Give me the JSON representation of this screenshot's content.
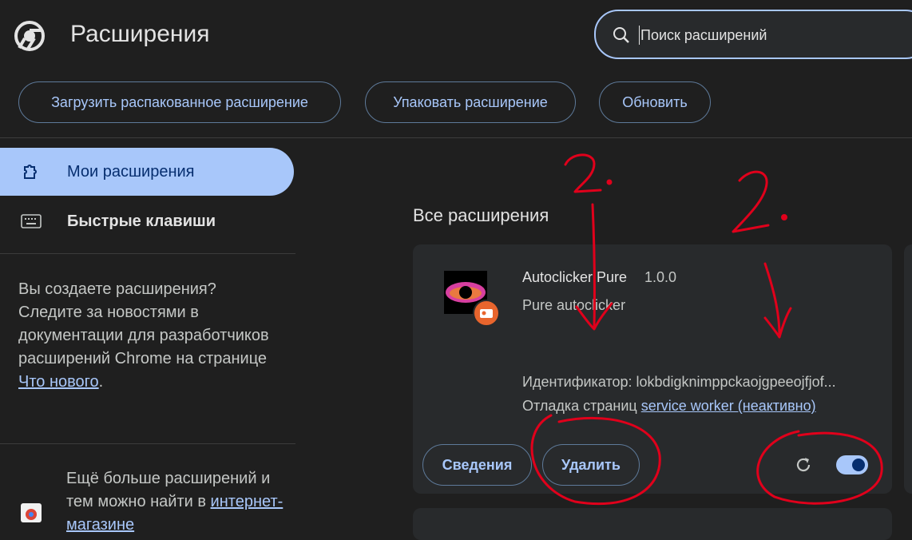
{
  "header": {
    "title": "Расширения",
    "search_placeholder": "Поиск расширений"
  },
  "toolbar": {
    "load_unpacked": "Загрузить распакованное расширение",
    "pack": "Упаковать расширение",
    "update": "Обновить"
  },
  "sidebar": {
    "items": [
      {
        "label": "Мои расширения",
        "icon": "puzzle-icon",
        "active": true
      },
      {
        "label": "Быстрые клавиши",
        "icon": "keyboard-icon",
        "active": false
      }
    ],
    "promo_text": "Вы создаете расширения? Следите за новостями в документации для разработчиков расширений Chrome на странице",
    "promo_link": "Что нового",
    "promo_end": ".",
    "store_text": "Ещё больше расширений и тем можно найти в",
    "store_link": "интернет-магазине"
  },
  "main": {
    "section_title": "Все расширения",
    "extension": {
      "name": "Autoclicker Pure",
      "version": "1.0.0",
      "description": "Pure autoclicker",
      "id_label": "Идентификатор: lokbdigknimppckaojgpeeojfjof...",
      "debug_label": "Отладка страниц",
      "debug_link": "service worker (неактивно)",
      "details_button": "Сведения",
      "remove_button": "Удалить",
      "enabled": true
    }
  },
  "annotations": {
    "mark_left": "2.",
    "mark_right": "2.",
    "color": "#e0001b"
  },
  "colors": {
    "background": "#1f1f1f",
    "card": "#282a2c",
    "accent": "#a8c7fa"
  }
}
